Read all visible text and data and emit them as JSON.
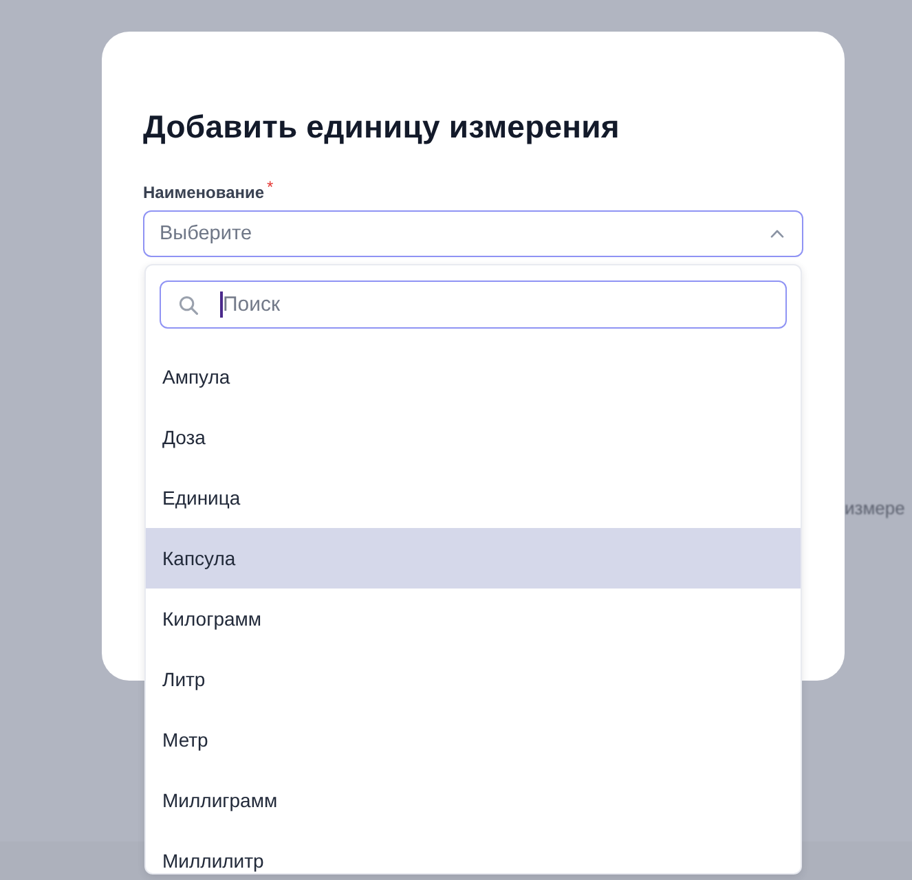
{
  "background": {
    "text": "измере"
  },
  "dialog": {
    "title": "Добавить единицу измерения",
    "field": {
      "label": "Наименование",
      "required_mark": "*",
      "placeholder": "Выберите",
      "expanded": true,
      "dropdown": {
        "search": {
          "placeholder": "Поиск",
          "focused": true
        },
        "options": [
          {
            "label": "Ампула",
            "highlighted": false
          },
          {
            "label": "Доза",
            "highlighted": false
          },
          {
            "label": "Единица",
            "highlighted": false
          },
          {
            "label": "Капсула",
            "highlighted": true
          },
          {
            "label": "Килограмм",
            "highlighted": false
          },
          {
            "label": "Литр",
            "highlighted": false
          },
          {
            "label": "Метр",
            "highlighted": false
          },
          {
            "label": "Миллиграмм",
            "highlighted": false
          },
          {
            "label": "Миллилитр",
            "highlighted": false
          }
        ]
      }
    }
  }
}
